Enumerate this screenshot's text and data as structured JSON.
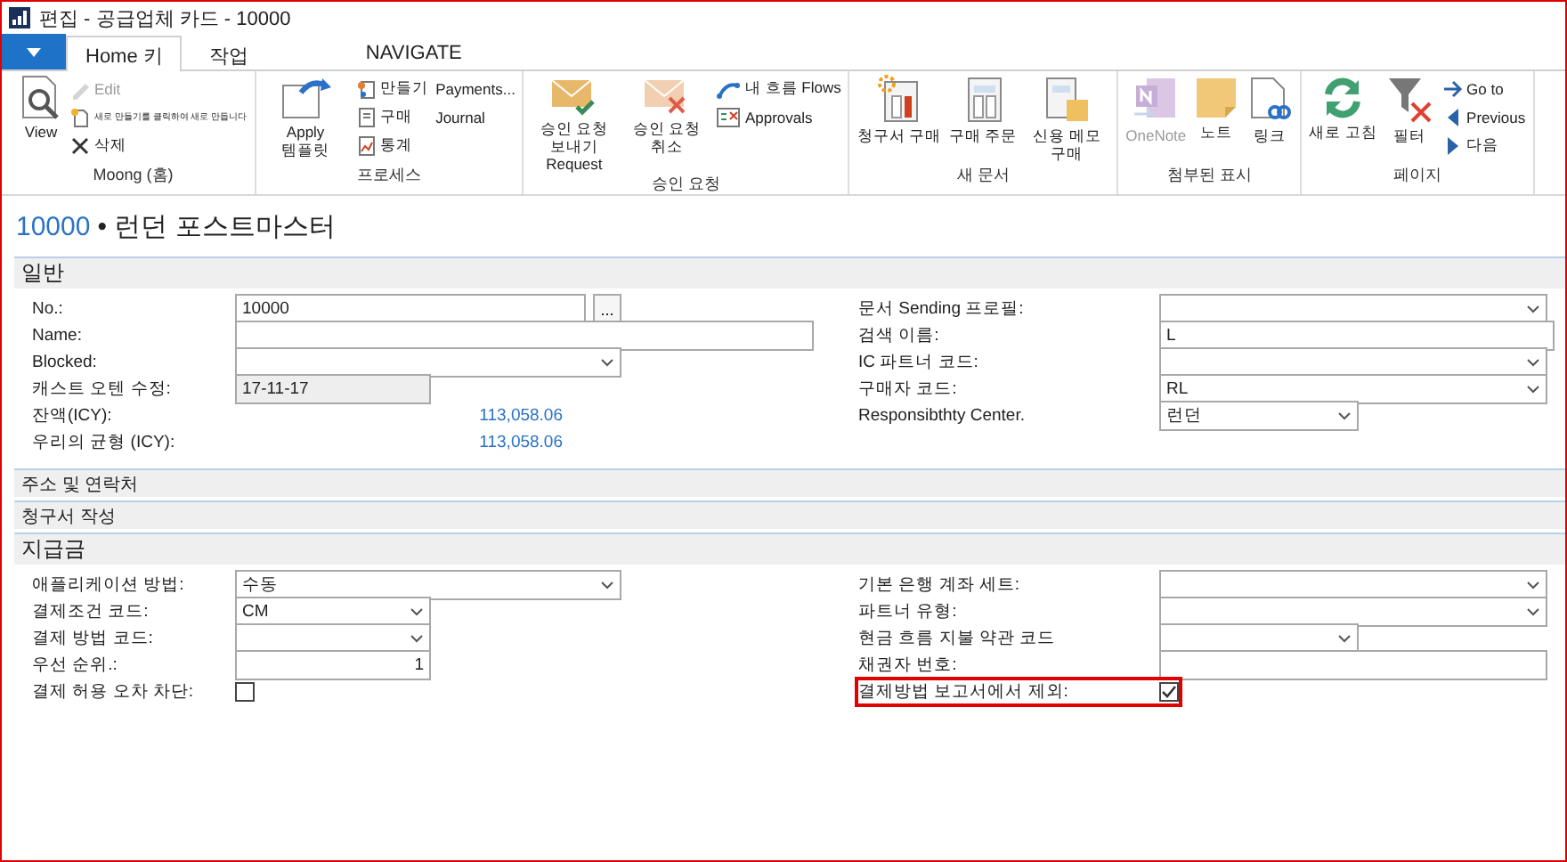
{
  "window": {
    "title": "편집 - 공급업체 카드 - 10000"
  },
  "tabs": [
    {
      "label": "Home 키",
      "selected": true
    },
    {
      "label": "작업",
      "selected": false
    },
    {
      "label": "NAVIGATE",
      "selected": false
    }
  ],
  "ribbon": {
    "groups": [
      {
        "label": "Moong (홈)",
        "items": [
          {
            "kind": "large",
            "label": "View",
            "disabled": false
          },
          {
            "kind": "small",
            "label": "Edit",
            "disabled": true
          },
          {
            "kind": "tiny",
            "label": "새로 만들기를 클릭하여 새로 만듭니다",
            "disabled": false
          },
          {
            "kind": "small",
            "label": "삭제",
            "disabled": false
          }
        ]
      },
      {
        "label": "프로세스",
        "items": [
          {
            "kind": "large",
            "label": "Apply 템플릿",
            "disabled": false
          },
          {
            "kind": "small",
            "label": "만들기",
            "disabled": false
          },
          {
            "kind": "small",
            "label": "구매",
            "disabled": false
          },
          {
            "kind": "small",
            "label": "통계",
            "disabled": false
          },
          {
            "kind": "small",
            "label": "Payments...",
            "disabled": false
          },
          {
            "kind": "small",
            "label": "Journal",
            "disabled": false
          }
        ]
      },
      {
        "label": "승인 요청",
        "items": [
          {
            "kind": "large",
            "label": "승인 요청 보내기 Request",
            "disabled": false
          },
          {
            "kind": "large",
            "label": "승인 요청 취소",
            "disabled": false
          },
          {
            "kind": "small",
            "label": "내 흐름 Flows",
            "disabled": false
          },
          {
            "kind": "small",
            "label": "Approvals",
            "disabled": false
          }
        ]
      },
      {
        "label": "새 문서",
        "items": [
          {
            "kind": "large",
            "label": "청구서 구매",
            "disabled": false
          },
          {
            "kind": "large",
            "label": "구매 주문",
            "disabled": false
          },
          {
            "kind": "large",
            "label": "신용 메모 구매",
            "disabled": false
          }
        ]
      },
      {
        "label": "첨부된 표시",
        "items": [
          {
            "kind": "large",
            "label": "OneNote",
            "disabled": true
          },
          {
            "kind": "large",
            "label": "노트",
            "disabled": false
          },
          {
            "kind": "large",
            "label": "링크",
            "disabled": false
          }
        ]
      },
      {
        "label": "페이지",
        "items": [
          {
            "kind": "large",
            "label": "새로 고침",
            "disabled": false
          },
          {
            "kind": "large",
            "label": "필터",
            "disabled": false
          },
          {
            "kind": "small",
            "label": "Go to",
            "disabled": false
          },
          {
            "kind": "small",
            "label": "Previous",
            "disabled": false
          },
          {
            "kind": "small",
            "label": "다음",
            "disabled": false
          }
        ]
      }
    ]
  },
  "record": {
    "number": "10000",
    "name": "• 런던 포스트마스터"
  },
  "sections": [
    {
      "title": "일반",
      "expanded": true,
      "columns": [
        [
          {
            "kind": "lookup",
            "label": "No.:",
            "value": "10000",
            "button": "...",
            "highlighted": false
          },
          {
            "kind": "text",
            "label": "Name:",
            "highlighted": false
          },
          {
            "kind": "select",
            "label": "Blocked:",
            "highlighted": false
          },
          {
            "kind": "readonly",
            "label": "캐스트 오텐 수정:",
            "value": "17-11-17",
            "highlighted": false
          },
          {
            "kind": "amount",
            "label": "잔액(ICY):",
            "value": "113,058.06",
            "highlighted": false
          },
          {
            "kind": "amount",
            "label": "우리의 균형 (ICY):",
            "value": "113,058.06",
            "highlighted": false
          }
        ],
        [
          {
            "kind": "select",
            "label": "문서 Sending 프로필:",
            "highlighted": false
          },
          {
            "kind": "text",
            "label": "검색 이름:",
            "value": "L",
            "highlighted": false
          },
          {
            "kind": "select",
            "label": "IC 파트너 코드:",
            "highlighted": false
          },
          {
            "kind": "select",
            "label": "구매자 코드:",
            "value": "RL",
            "highlighted": false
          },
          {
            "kind": "select",
            "label": "Responsibthty Center.",
            "value": "런던",
            "highlighted": false
          }
        ]
      ]
    },
    {
      "title": "주소 및 연락처",
      "expanded": false
    },
    {
      "title": "청구서 작성",
      "expanded": false
    },
    {
      "title": "지급금",
      "expanded": true,
      "columns": [
        [
          {
            "kind": "select",
            "label": "애플리케이션 방법:",
            "value": "수동",
            "highlighted": false
          },
          {
            "kind": "select",
            "label": "결제조건 코드:",
            "value": "CM",
            "highlighted": false
          },
          {
            "kind": "select",
            "label": "결제 방법 코드:",
            "highlighted": false
          },
          {
            "kind": "number",
            "label": "우선 순위.:",
            "value": "1",
            "highlighted": false
          },
          {
            "kind": "checkbox",
            "label": "결제 허용 오차 차단:",
            "checked": false,
            "highlighted": false
          }
        ],
        [
          {
            "kind": "select",
            "label": "기본 은행 계좌 세트:",
            "highlighted": false
          },
          {
            "kind": "select",
            "label": "파트너 유형:",
            "highlighted": false
          },
          {
            "kind": "select",
            "label": "현금 흐름 지불 약관 코드",
            "highlighted": false
          },
          {
            "kind": "text",
            "label": "채권자 번호:",
            "highlighted": false
          },
          {
            "kind": "checkbox",
            "label": "결제방법 보고서에서 제외:",
            "checked": true,
            "highlighted": true
          }
        ]
      ]
    }
  ]
}
